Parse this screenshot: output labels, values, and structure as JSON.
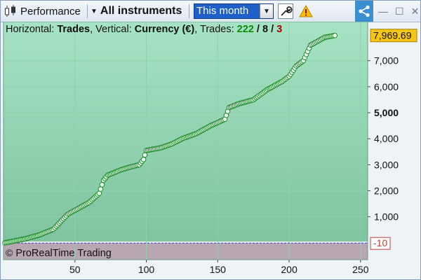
{
  "toolbar": {
    "performance_label": "Performance",
    "instrument_label": "All instruments",
    "period_value": "This month"
  },
  "caption": {
    "horizontal_label": "Horizontal:",
    "horizontal_value": "Trades",
    "vertical_label": "Vertical:",
    "vertical_value": "Currency (€)",
    "trades_label": "Trades:",
    "trades_total": "222",
    "trades_losing": "8",
    "trades_other": "3",
    "slash": "/"
  },
  "copyright": "ProRealTime Trading",
  "copyright_symbol": "©",
  "colors": {
    "plot_top": "#a6e3c4",
    "plot_bottom": "#7fc3a0",
    "negative_zone": "#b9a6b3",
    "line": "#1f8a2a",
    "last_value_box": "#f5c518",
    "accent_blue": "#1f5fc8"
  },
  "chart_data": {
    "type": "scatter",
    "x_ticks": [
      50,
      100,
      150,
      200,
      250
    ],
    "x_tick_labels": [
      "50",
      "100",
      "150",
      "200",
      "250"
    ],
    "y_ticks": [
      1000,
      2000,
      3000,
      4000,
      5000,
      6000,
      7000
    ],
    "y_tick_labels": [
      "1,000",
      "2,000",
      "3,000",
      "4,000",
      "5,000",
      "6,000",
      "7,000"
    ],
    "xlim": [
      0,
      255
    ],
    "ylim": [
      -650,
      8500
    ],
    "grid": true,
    "last_value": 7969.69,
    "last_value_label": "7,969.69",
    "baseline_value": -10,
    "baseline_label": "-10",
    "anchors": [
      [
        1,
        0
      ],
      [
        15,
        150
      ],
      [
        25,
        300
      ],
      [
        35,
        520
      ],
      [
        45,
        1100
      ],
      [
        55,
        1400
      ],
      [
        60,
        1550
      ],
      [
        67,
        1900
      ],
      [
        70,
        2400
      ],
      [
        73,
        2600
      ],
      [
        82,
        2800
      ],
      [
        88,
        2900
      ],
      [
        95,
        3000
      ],
      [
        98,
        3200
      ],
      [
        100,
        3550
      ],
      [
        110,
        3650
      ],
      [
        118,
        3800
      ],
      [
        125,
        4000
      ],
      [
        135,
        4200
      ],
      [
        145,
        4500
      ],
      [
        155,
        4750
      ],
      [
        158,
        5200
      ],
      [
        165,
        5350
      ],
      [
        175,
        5500
      ],
      [
        185,
        5900
      ],
      [
        195,
        6200
      ],
      [
        200,
        6400
      ],
      [
        205,
        6800
      ],
      [
        210,
        7000
      ],
      [
        215,
        7600
      ],
      [
        220,
        7750
      ],
      [
        225,
        7900
      ],
      [
        232,
        7969.69
      ]
    ]
  }
}
